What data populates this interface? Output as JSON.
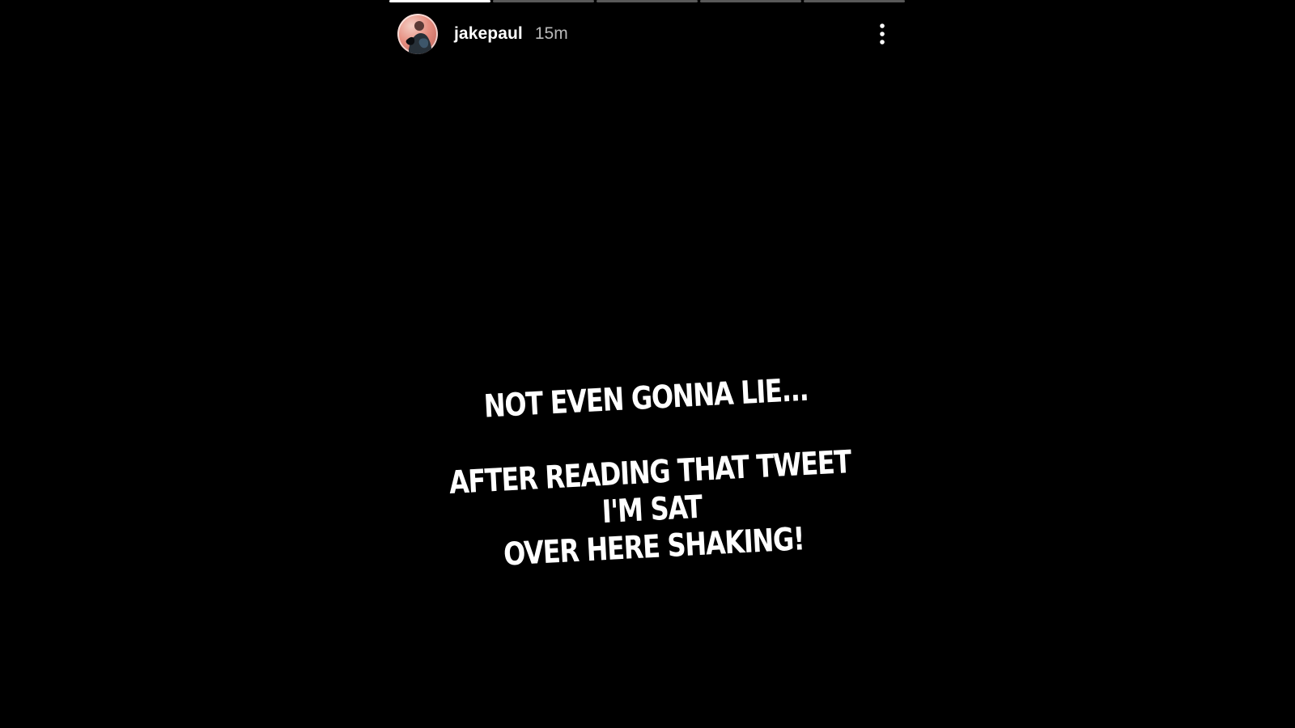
{
  "story": {
    "progress_segments": [
      1,
      0,
      0,
      0,
      0
    ],
    "user": {
      "username": "jakepaul",
      "timestamp": "15m",
      "avatar_icon": "profile-photo-icon"
    },
    "menu_icon": "more-vertical-icon",
    "text": {
      "line1": "NOT EVEN GONNA LIE...",
      "line2": "AFTER READING THAT TWEET I'M SAT",
      "line3": "OVER HERE SHAKING!"
    }
  },
  "colors": {
    "background": "#000000",
    "text": "#ffffff",
    "progress_track": "rgba(255,255,255,0.35)",
    "progress_fill": "#ffffff"
  }
}
